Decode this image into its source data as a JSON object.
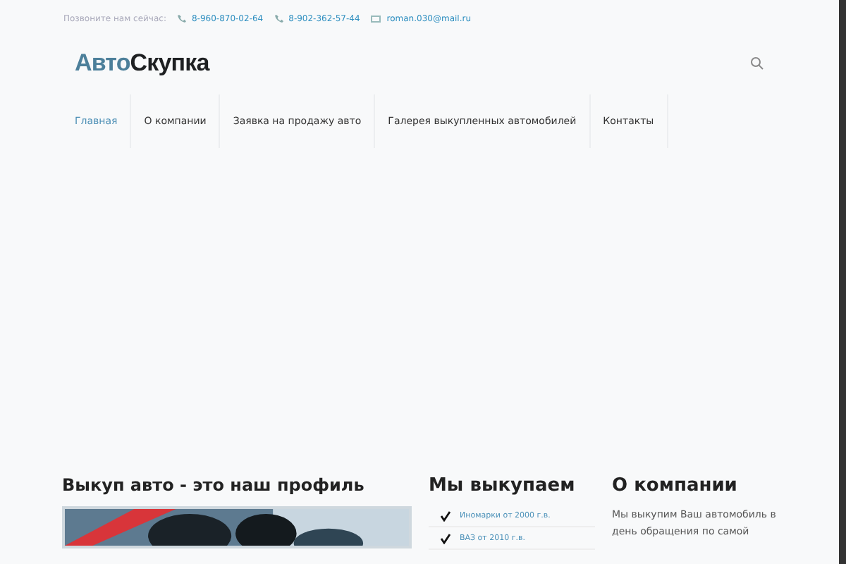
{
  "topbar": {
    "call_text": "Позвоните нам сейчас:",
    "phones": [
      "8-960-870-02-64",
      "8-902-362-57-44"
    ],
    "email": "roman.030@mail.ru"
  },
  "logo": {
    "part_1": "Авто",
    "part_2": "Скупка"
  },
  "nav": [
    {
      "label": "Главная",
      "selected": true
    },
    {
      "label": "О компании",
      "selected": false
    },
    {
      "label": "Заявка на продажу авто",
      "selected": false
    },
    {
      "label": "Галерея выкупленных автомобилей",
      "selected": false
    },
    {
      "label": "Контакты",
      "selected": false
    }
  ],
  "section_1": {
    "title": "Выкуп авто - это наш профиль"
  },
  "section_2": {
    "title": "Мы выкупаем",
    "items": [
      "Иномарки от 2000 г.в.",
      "ВАЗ от 2010 г.в."
    ]
  },
  "section_3": {
    "title": "О компании",
    "text": "Мы выкупим Ваш автомобиль в день обращения по самой"
  }
}
